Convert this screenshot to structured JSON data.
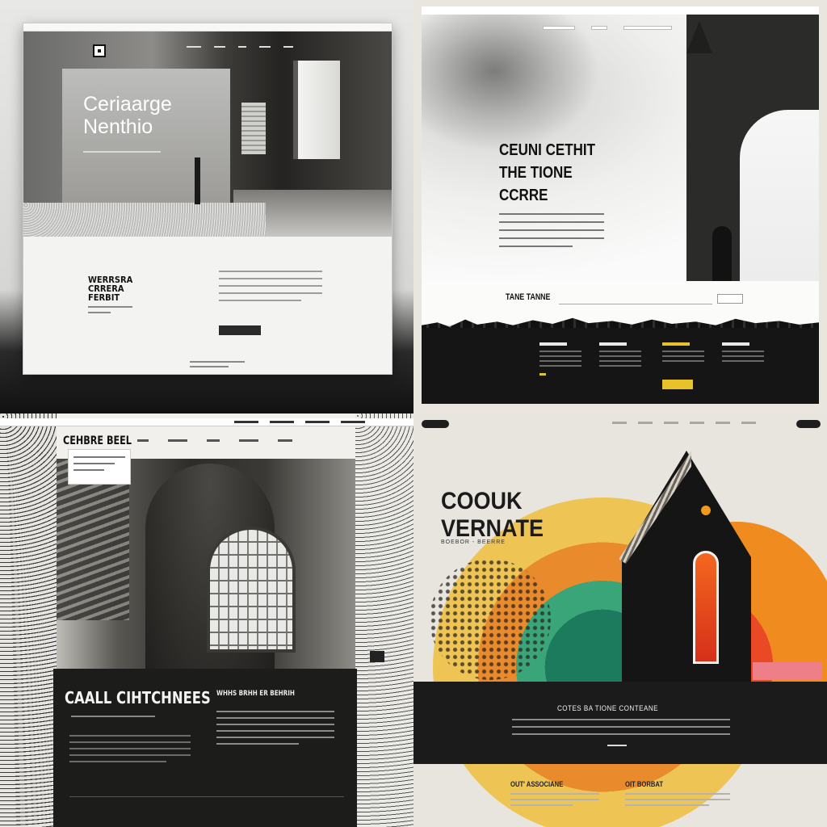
{
  "panels": {
    "gray_concrete": {
      "hero_title": "Ceriaarge\nNenthio",
      "section_title": "WERRSRA\nCRRERA\nFERBIT",
      "nav_items": [
        "",
        "",
        "",
        "",
        ""
      ],
      "cta_label": ""
    },
    "gothic_tower": {
      "nav_items": [
        "",
        "",
        ""
      ],
      "hero_title": "CEUNI CETHIT\nTHE TIONE\nCCRRE",
      "band_label": "TANE TANNE",
      "band_button": "",
      "footer_button": "",
      "accent_color": "#e9c12a"
    },
    "cathedral_window": {
      "brand": "CEHBRE BEEL",
      "nav_items": [
        "",
        "",
        "",
        "",
        ""
      ],
      "dark_title": "CAALL CIHTCHNEES",
      "column_title": "WHHS BRHH ER BEHRIH"
    },
    "rainbow_church": {
      "hero_title": "COOUK\nVERNATE",
      "hero_sub": "BOEBOR - BEERRE",
      "band_title": "COTES BA TIONE CONTEANE",
      "footer_left_title": "OUT' ASSOCIANE",
      "footer_right_title": "OIT BORBAT",
      "colors": {
        "yellow": "#eec454",
        "orange": "#f08b20",
        "green": "#3aa579",
        "red": "#d6301a",
        "pink": "#ee7f88"
      }
    }
  }
}
